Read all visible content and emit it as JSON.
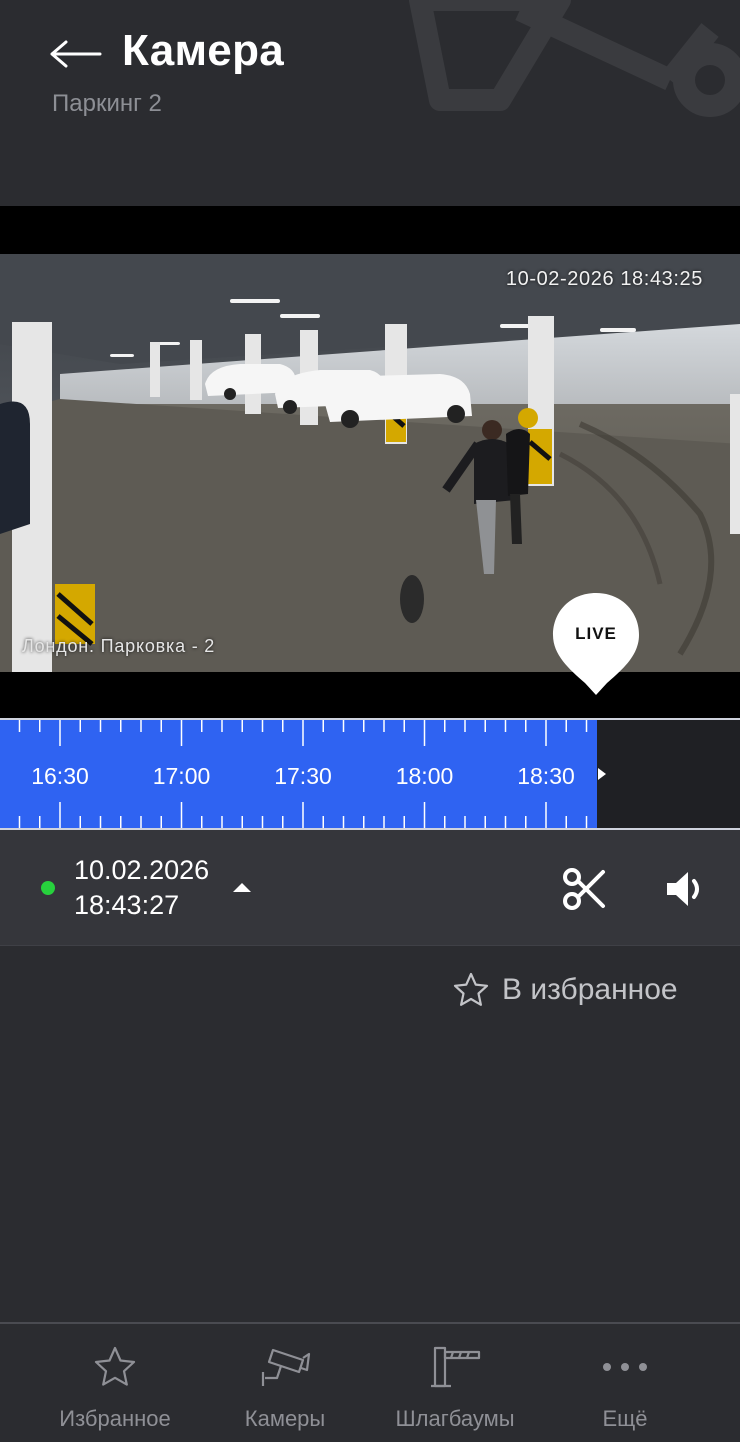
{
  "header": {
    "title": "Камера",
    "subtitle": "Паркинг 2"
  },
  "video": {
    "timestamp_overlay": "10-02-2026 18:43:25",
    "camera_name_overlay": "Лондон. Парковка - 2",
    "live_badge": "LIVE"
  },
  "timeline": {
    "labels": [
      "16:30",
      "17:00",
      "17:30",
      "18:00",
      "18:30"
    ],
    "colors": {
      "recorded": "#2f63f2",
      "empty": "#1f2024"
    }
  },
  "controls": {
    "status_color": "#27d13d",
    "date": "10.02.2026",
    "time": "18:43:27",
    "icons": [
      "chevron-up-icon",
      "scissors-icon",
      "volume-icon"
    ]
  },
  "favorite": {
    "label": "В избранное",
    "icon": "star-outline-icon"
  },
  "bottom_nav": {
    "items": [
      {
        "label": "Избранное",
        "icon": "star-icon"
      },
      {
        "label": "Камеры",
        "icon": "camera-icon"
      },
      {
        "label": "Шлагбаумы",
        "icon": "barrier-icon"
      },
      {
        "label": "Ещё",
        "icon": "more-icon"
      }
    ]
  }
}
